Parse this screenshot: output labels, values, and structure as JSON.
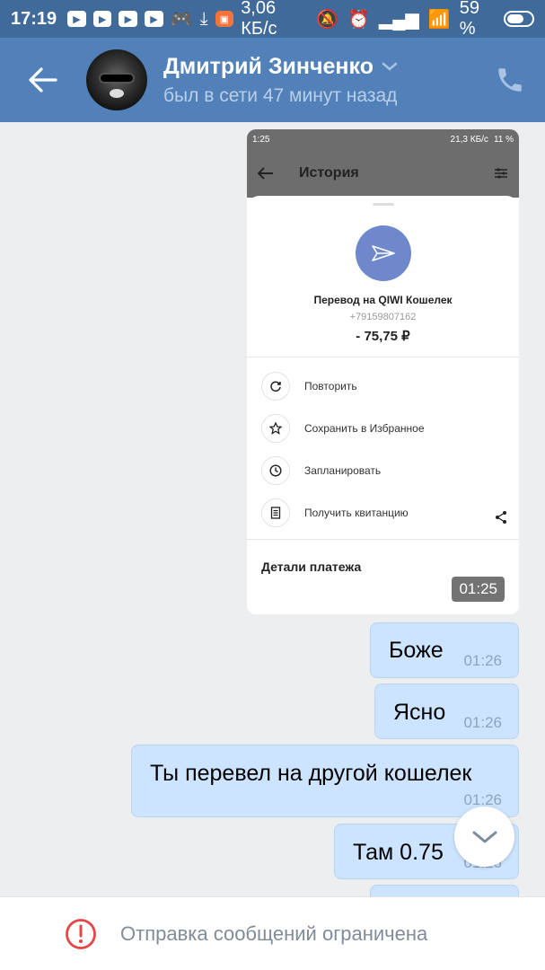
{
  "status_bar": {
    "time": "17:19",
    "speed": "3,06 КБ/с",
    "battery": "59 %"
  },
  "header": {
    "name": "Дмитрий Зинченко",
    "status": "был в сети 47 минут назад"
  },
  "attachment": {
    "status_time": "1:25",
    "status_speed": "21,3 КБ/с",
    "status_battery": "11 %",
    "title": "История",
    "transfer_title": "Перевод на QIWI Кошелек",
    "phone": "+79159807162",
    "amount": "- 75,75 ₽",
    "actions": [
      "Повторить",
      "Сохранить в Избранное",
      "Запланировать",
      "Получить квитанцию"
    ],
    "details": "Детали платежа",
    "time": "01:25"
  },
  "messages": [
    {
      "text": "Боже",
      "time": "01:26"
    },
    {
      "text": "Ясно",
      "time": "01:26"
    },
    {
      "text": "Ты перевел на другой кошелек",
      "time": "01:26"
    },
    {
      "text": "Там 0.75",
      "time": "01:26"
    }
  ],
  "bottom": {
    "text": "Отправка сообщений ограничена"
  },
  "colors": {
    "header": "#5181b8",
    "bubble": "#cce4ff",
    "warning": "#e64646"
  }
}
